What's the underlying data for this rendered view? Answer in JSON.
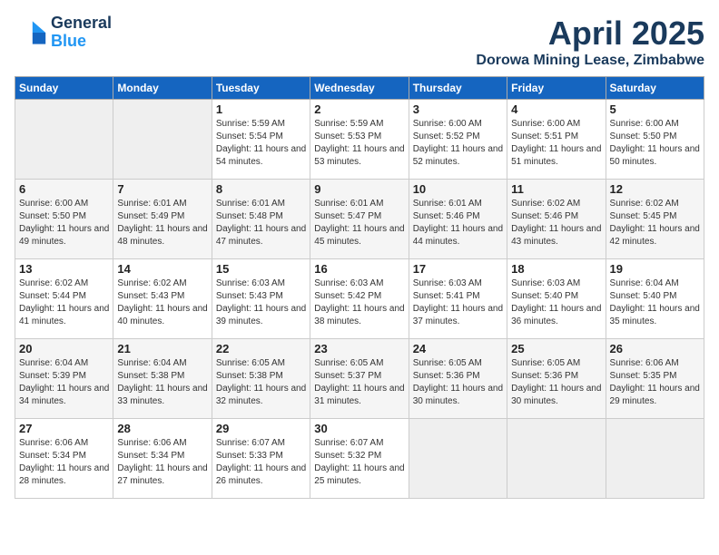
{
  "header": {
    "logo_line1": "General",
    "logo_line2": "Blue",
    "month": "April 2025",
    "location": "Dorowa Mining Lease, Zimbabwe"
  },
  "weekdays": [
    "Sunday",
    "Monday",
    "Tuesday",
    "Wednesday",
    "Thursday",
    "Friday",
    "Saturday"
  ],
  "weeks": [
    [
      {
        "day": "",
        "sunrise": "",
        "sunset": "",
        "daylight": ""
      },
      {
        "day": "",
        "sunrise": "",
        "sunset": "",
        "daylight": ""
      },
      {
        "day": "1",
        "sunrise": "Sunrise: 5:59 AM",
        "sunset": "Sunset: 5:54 PM",
        "daylight": "Daylight: 11 hours and 54 minutes."
      },
      {
        "day": "2",
        "sunrise": "Sunrise: 5:59 AM",
        "sunset": "Sunset: 5:53 PM",
        "daylight": "Daylight: 11 hours and 53 minutes."
      },
      {
        "day": "3",
        "sunrise": "Sunrise: 6:00 AM",
        "sunset": "Sunset: 5:52 PM",
        "daylight": "Daylight: 11 hours and 52 minutes."
      },
      {
        "day": "4",
        "sunrise": "Sunrise: 6:00 AM",
        "sunset": "Sunset: 5:51 PM",
        "daylight": "Daylight: 11 hours and 51 minutes."
      },
      {
        "day": "5",
        "sunrise": "Sunrise: 6:00 AM",
        "sunset": "Sunset: 5:50 PM",
        "daylight": "Daylight: 11 hours and 50 minutes."
      }
    ],
    [
      {
        "day": "6",
        "sunrise": "Sunrise: 6:00 AM",
        "sunset": "Sunset: 5:50 PM",
        "daylight": "Daylight: 11 hours and 49 minutes."
      },
      {
        "day": "7",
        "sunrise": "Sunrise: 6:01 AM",
        "sunset": "Sunset: 5:49 PM",
        "daylight": "Daylight: 11 hours and 48 minutes."
      },
      {
        "day": "8",
        "sunrise": "Sunrise: 6:01 AM",
        "sunset": "Sunset: 5:48 PM",
        "daylight": "Daylight: 11 hours and 47 minutes."
      },
      {
        "day": "9",
        "sunrise": "Sunrise: 6:01 AM",
        "sunset": "Sunset: 5:47 PM",
        "daylight": "Daylight: 11 hours and 45 minutes."
      },
      {
        "day": "10",
        "sunrise": "Sunrise: 6:01 AM",
        "sunset": "Sunset: 5:46 PM",
        "daylight": "Daylight: 11 hours and 44 minutes."
      },
      {
        "day": "11",
        "sunrise": "Sunrise: 6:02 AM",
        "sunset": "Sunset: 5:46 PM",
        "daylight": "Daylight: 11 hours and 43 minutes."
      },
      {
        "day": "12",
        "sunrise": "Sunrise: 6:02 AM",
        "sunset": "Sunset: 5:45 PM",
        "daylight": "Daylight: 11 hours and 42 minutes."
      }
    ],
    [
      {
        "day": "13",
        "sunrise": "Sunrise: 6:02 AM",
        "sunset": "Sunset: 5:44 PM",
        "daylight": "Daylight: 11 hours and 41 minutes."
      },
      {
        "day": "14",
        "sunrise": "Sunrise: 6:02 AM",
        "sunset": "Sunset: 5:43 PM",
        "daylight": "Daylight: 11 hours and 40 minutes."
      },
      {
        "day": "15",
        "sunrise": "Sunrise: 6:03 AM",
        "sunset": "Sunset: 5:43 PM",
        "daylight": "Daylight: 11 hours and 39 minutes."
      },
      {
        "day": "16",
        "sunrise": "Sunrise: 6:03 AM",
        "sunset": "Sunset: 5:42 PM",
        "daylight": "Daylight: 11 hours and 38 minutes."
      },
      {
        "day": "17",
        "sunrise": "Sunrise: 6:03 AM",
        "sunset": "Sunset: 5:41 PM",
        "daylight": "Daylight: 11 hours and 37 minutes."
      },
      {
        "day": "18",
        "sunrise": "Sunrise: 6:03 AM",
        "sunset": "Sunset: 5:40 PM",
        "daylight": "Daylight: 11 hours and 36 minutes."
      },
      {
        "day": "19",
        "sunrise": "Sunrise: 6:04 AM",
        "sunset": "Sunset: 5:40 PM",
        "daylight": "Daylight: 11 hours and 35 minutes."
      }
    ],
    [
      {
        "day": "20",
        "sunrise": "Sunrise: 6:04 AM",
        "sunset": "Sunset: 5:39 PM",
        "daylight": "Daylight: 11 hours and 34 minutes."
      },
      {
        "day": "21",
        "sunrise": "Sunrise: 6:04 AM",
        "sunset": "Sunset: 5:38 PM",
        "daylight": "Daylight: 11 hours and 33 minutes."
      },
      {
        "day": "22",
        "sunrise": "Sunrise: 6:05 AM",
        "sunset": "Sunset: 5:38 PM",
        "daylight": "Daylight: 11 hours and 32 minutes."
      },
      {
        "day": "23",
        "sunrise": "Sunrise: 6:05 AM",
        "sunset": "Sunset: 5:37 PM",
        "daylight": "Daylight: 11 hours and 31 minutes."
      },
      {
        "day": "24",
        "sunrise": "Sunrise: 6:05 AM",
        "sunset": "Sunset: 5:36 PM",
        "daylight": "Daylight: 11 hours and 30 minutes."
      },
      {
        "day": "25",
        "sunrise": "Sunrise: 6:05 AM",
        "sunset": "Sunset: 5:36 PM",
        "daylight": "Daylight: 11 hours and 30 minutes."
      },
      {
        "day": "26",
        "sunrise": "Sunrise: 6:06 AM",
        "sunset": "Sunset: 5:35 PM",
        "daylight": "Daylight: 11 hours and 29 minutes."
      }
    ],
    [
      {
        "day": "27",
        "sunrise": "Sunrise: 6:06 AM",
        "sunset": "Sunset: 5:34 PM",
        "daylight": "Daylight: 11 hours and 28 minutes."
      },
      {
        "day": "28",
        "sunrise": "Sunrise: 6:06 AM",
        "sunset": "Sunset: 5:34 PM",
        "daylight": "Daylight: 11 hours and 27 minutes."
      },
      {
        "day": "29",
        "sunrise": "Sunrise: 6:07 AM",
        "sunset": "Sunset: 5:33 PM",
        "daylight": "Daylight: 11 hours and 26 minutes."
      },
      {
        "day": "30",
        "sunrise": "Sunrise: 6:07 AM",
        "sunset": "Sunset: 5:32 PM",
        "daylight": "Daylight: 11 hours and 25 minutes."
      },
      {
        "day": "",
        "sunrise": "",
        "sunset": "",
        "daylight": ""
      },
      {
        "day": "",
        "sunrise": "",
        "sunset": "",
        "daylight": ""
      },
      {
        "day": "",
        "sunrise": "",
        "sunset": "",
        "daylight": ""
      }
    ]
  ]
}
